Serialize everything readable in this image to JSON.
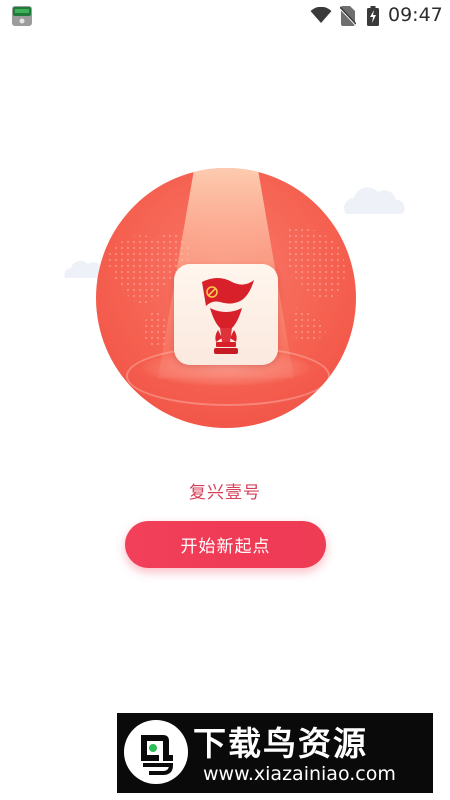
{
  "status_bar": {
    "time": "09:47",
    "icons": [
      "app-notification-icon",
      "wifi-icon",
      "no-sim-icon",
      "battery-charging-icon"
    ]
  },
  "splash": {
    "app_name": "复兴壹号",
    "start_button_label": "开始新起点",
    "logo_icon": "torch-flag-icon",
    "colors": {
      "accent": "#f03a56",
      "app_name_text": "#d6405a",
      "circle": "#f5604f"
    }
  },
  "watermark": {
    "logo_icon": "bird-logo-icon",
    "title": "下载鸟资源",
    "url": "www.xiazainiao.com"
  }
}
